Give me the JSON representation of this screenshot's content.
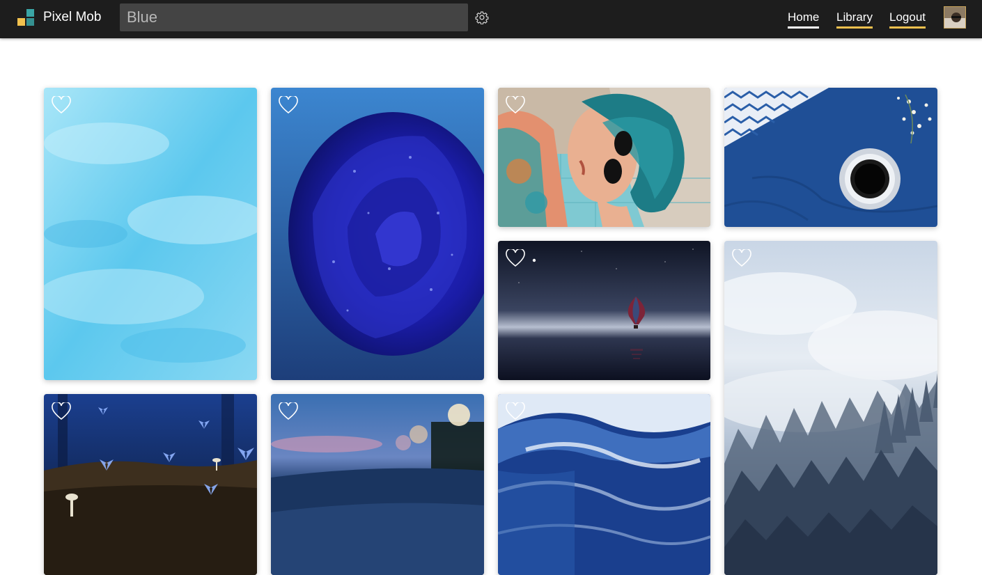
{
  "app": {
    "name": "Pixel Mob"
  },
  "search": {
    "value": "Blue"
  },
  "icons": {
    "logo": "pixel-mob-logo",
    "settings": "gear-icon",
    "favorite": "heart-outline-icon",
    "avatar": "user-avatar"
  },
  "nav": {
    "home": "Home",
    "library": "Library",
    "logout": "Logout"
  },
  "colors": {
    "topbar": "#1d1d1d",
    "search_bg": "#444444",
    "nav_active_underline": "#ffffff",
    "nav_underline": "#f2c14e",
    "logo_yellow": "#f2c14e",
    "logo_teal": "#3aa6a6"
  },
  "gallery": {
    "images": [
      {
        "subject": "blue water surface"
      },
      {
        "subject": "blue rose with water droplets"
      },
      {
        "subject": "woman with teal hair and sunglasses"
      },
      {
        "subject": "coffee cup on blue linen"
      },
      {
        "subject": "hot air balloon over dark sea"
      },
      {
        "subject": "misty forest under cloudy sky"
      },
      {
        "subject": "blue butterflies in a dark forest"
      },
      {
        "subject": "blurred blue road with bokeh"
      },
      {
        "subject": "blue ocean waves"
      }
    ]
  }
}
